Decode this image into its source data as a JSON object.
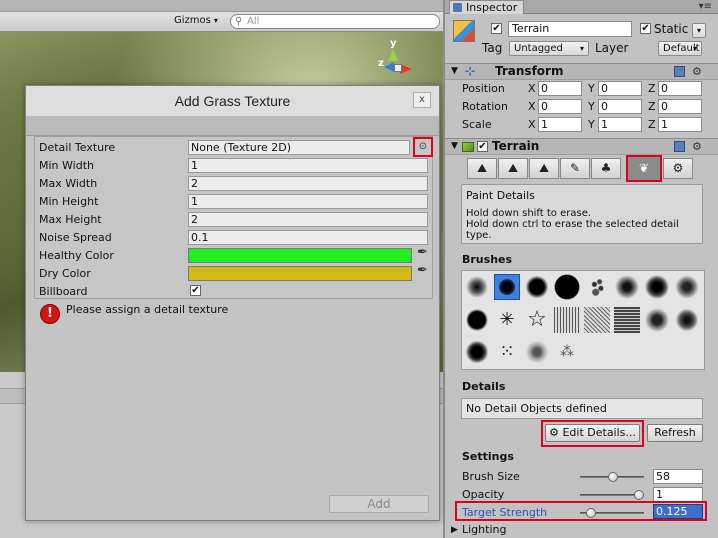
{
  "scene": {
    "gizmos_label": "Gizmos",
    "search_placeholder": "All",
    "axis_y": "y",
    "axis_z": "z"
  },
  "dialog": {
    "title": "Add Grass Texture",
    "close_label": "x",
    "rows": {
      "detail_texture": {
        "label": "Detail Texture",
        "value": "None (Texture 2D)"
      },
      "min_width": {
        "label": "Min Width",
        "value": "1"
      },
      "max_width": {
        "label": "Max Width",
        "value": "2"
      },
      "min_height": {
        "label": "Min Height",
        "value": "1"
      },
      "max_height": {
        "label": "Max Height",
        "value": "2"
      },
      "noise_spread": {
        "label": "Noise Spread",
        "value": "0.1"
      },
      "healthy_color": {
        "label": "Healthy Color",
        "color": "#22ee22"
      },
      "dry_color": {
        "label": "Dry Color",
        "color": "#d2b916"
      },
      "billboard": {
        "label": "Billboard",
        "checked": true
      }
    },
    "error_text": "Please assign a detail texture",
    "add_label": "Add"
  },
  "inspector": {
    "tab_label": "Inspector",
    "object_name": "Terrain",
    "static_label": "Static",
    "tag_label": "Tag",
    "tag_value": "Untagged",
    "layer_label": "Layer",
    "layer_value": "Default",
    "transform": {
      "title": "Transform",
      "position": {
        "label": "Position",
        "x": "0",
        "y": "0",
        "z": "0"
      },
      "rotation": {
        "label": "Rotation",
        "x": "0",
        "y": "0",
        "z": "0"
      },
      "scale": {
        "label": "Scale",
        "x": "1",
        "y": "1",
        "z": "1"
      },
      "axis": {
        "x": "X",
        "y": "Y",
        "z": "Z"
      }
    },
    "terrain": {
      "title": "Terrain",
      "help_title": "Paint Details",
      "help_line1": "Hold down shift to erase.",
      "help_line2": "Hold down ctrl to erase the selected detail",
      "help_line3": "type.",
      "brushes_label": "Brushes",
      "details_label": "Details",
      "details_empty": "No Detail Objects defined",
      "edit_details_label": "Edit Details...",
      "refresh_label": "Refresh",
      "settings_label": "Settings",
      "brush_size": {
        "label": "Brush Size",
        "value": "58",
        "fraction": 0.52
      },
      "opacity": {
        "label": "Opacity",
        "value": "1",
        "fraction": 1.0
      },
      "target_strength": {
        "label": "Target Strength",
        "value": "0.125",
        "fraction": 0.12
      },
      "lighting_label": "Lighting"
    }
  },
  "colors": {
    "highlight_red": "#e0001b",
    "selection_blue": "#3d6fc9"
  }
}
